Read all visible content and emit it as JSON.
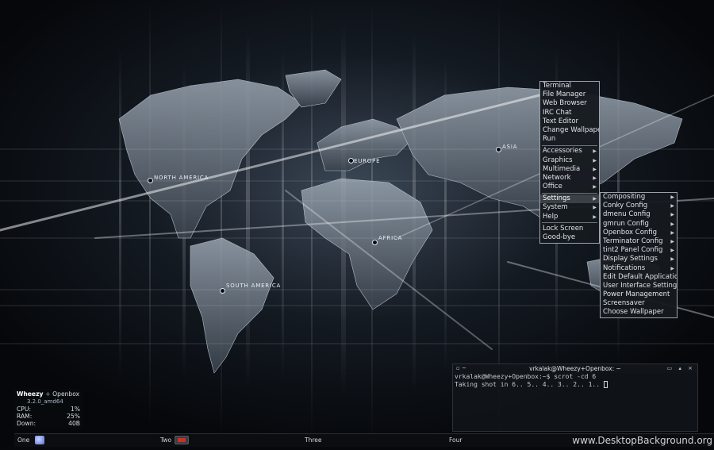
{
  "wallpaper": {
    "labels": {
      "north_america": "NORTH AMERICA",
      "europe": "EUROPE",
      "asia": "ASIA",
      "africa": "AFRICA",
      "south_america": "SOUTH AMERICA"
    }
  },
  "root_menu": {
    "items": [
      {
        "label": "Terminal"
      },
      {
        "label": "File Manager"
      },
      {
        "label": "Web Browser"
      },
      {
        "label": "IRC Chat"
      },
      {
        "label": "Text Editor"
      },
      {
        "label": "Change Wallpaper"
      },
      {
        "label": "Run"
      },
      {
        "label": "Accessories"
      },
      {
        "label": "Graphics"
      },
      {
        "label": "Multimedia"
      },
      {
        "label": "Network"
      },
      {
        "label": "Office"
      },
      {
        "label": "Settings"
      },
      {
        "label": "System"
      },
      {
        "label": "Help"
      },
      {
        "label": "Lock Screen"
      },
      {
        "label": "Good-bye"
      }
    ]
  },
  "settings_menu": {
    "items": [
      {
        "label": "Compositing"
      },
      {
        "label": "Conky Config"
      },
      {
        "label": "dmenu Config"
      },
      {
        "label": "gmrun Config"
      },
      {
        "label": "Openbox Config"
      },
      {
        "label": "Terminator Config"
      },
      {
        "label": "tint2 Panel Config"
      },
      {
        "label": "Display Settings"
      },
      {
        "label": "Notifications"
      },
      {
        "label": "Edit Default Applications"
      },
      {
        "label": "User Interface Settings"
      },
      {
        "label": "Power Management"
      },
      {
        "label": "Screensaver"
      },
      {
        "label": "Choose Wallpaper"
      }
    ]
  },
  "conky": {
    "title_host": "Wheezy",
    "title_plus": "+",
    "title_wm": "Openbox",
    "kernel": "3.2.0_amd64",
    "cpu_label": "CPU:",
    "cpu_value": "1%",
    "ram_label": "RAM:",
    "ram_value": "25%",
    "down_label": "Down:",
    "down_value": "40B"
  },
  "terminal": {
    "menu_glyph": "▫ ~",
    "title": "vrkalak@Wheezy+Openbox: ~",
    "controls": "▭ ▴ ×",
    "line1": "vrkalak@Wheezy+Openbox:~$ scrot -cd 6",
    "line2": "Taking shot in 6.. 5.. 4.. 3.. 2.. 1.. "
  },
  "panel": {
    "desktops": [
      "One",
      "Two",
      "Three",
      "Four"
    ]
  },
  "watermark": "www.DesktopBackground.org",
  "colors": {
    "menu_bg": "#16191e",
    "menu_border": "#9aa3ad",
    "menu_active": "#3b4047",
    "panel_bg": "#0b0d10"
  }
}
